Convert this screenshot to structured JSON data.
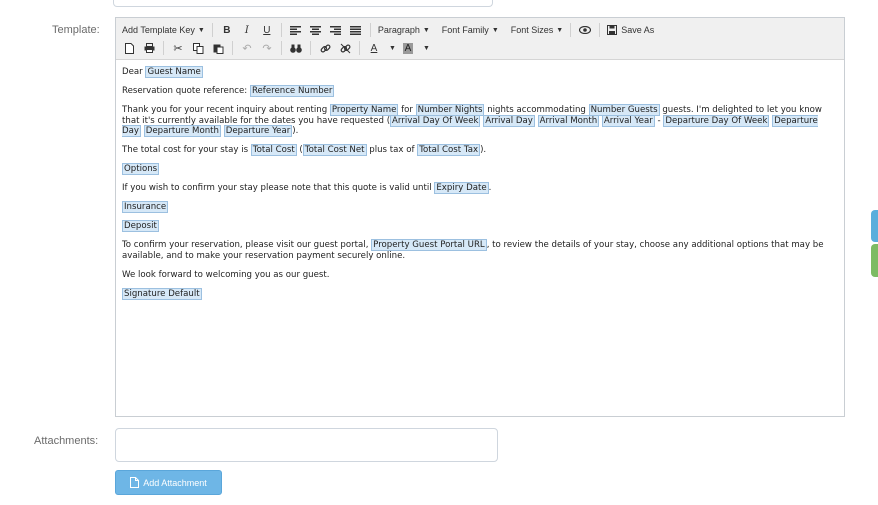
{
  "form": {
    "template_label": "Template:",
    "attachments_label": "Attachments:",
    "add_attachment_label": "Add Attachment",
    "attachments_value": ""
  },
  "toolbar": {
    "add_template_key": "Add Template Key",
    "bold": "B",
    "italic": "I",
    "underline": "U",
    "paragraph": "Paragraph",
    "font_family": "Font Family",
    "font_sizes": "Font Sizes",
    "save_as": "Save As",
    "text_color": "A",
    "bg_color": "A"
  },
  "letter": {
    "p1": {
      "t1": "Dear ",
      "k1": "Guest Name"
    },
    "p2": {
      "t1": "Reservation quote reference: ",
      "k1": "Reference Number"
    },
    "p3": {
      "t1": "Thank you for your recent inquiry about renting ",
      "k1": "Property Name",
      "t2": " for ",
      "k2": "Number Nights",
      "t3": " nights accommodating ",
      "k3": "Number Guests",
      "t4": " guests. I'm delighted to let you know that it's currently available for the dates you have requested (",
      "k4": "Arrival Day Of Week",
      "t5": " ",
      "k5": "Arrival Day",
      "t6": " ",
      "k6": "Arrival Month",
      "t7": " ",
      "k7": "Arrival Year",
      "t8": " - ",
      "k8": "Departure Day Of Week",
      "t9": " ",
      "k9": "Departure Day",
      "t10": " ",
      "k10": "Departure Month",
      "t11": " ",
      "k11": "Departure Year",
      "t12": ")."
    },
    "p4": {
      "t1": "The total cost for your stay is ",
      "k1": "Total Cost",
      "t2": " (",
      "k2": "Total Cost Net",
      "t3": " plus tax of ",
      "k3": "Total Cost Tax",
      "t4": ")."
    },
    "p5": {
      "k1": "Options"
    },
    "p6": {
      "t1": "If you wish to confirm your stay please note that this quote is valid until ",
      "k1": "Expiry Date",
      "t2": "."
    },
    "p7": {
      "k1": "Insurance"
    },
    "p8": {
      "k1": "Deposit"
    },
    "p9": {
      "t1": "To confirm your reservation, please visit our guest portal, ",
      "k1": "Property Guest Portal URL",
      "t2": ", to review the details of your stay, choose any additional options that may be available, and to make your reservation payment securely online."
    },
    "p10": {
      "t1": "We look forward to welcoming you as our guest."
    },
    "p11": {
      "k1": "Signature Default"
    }
  },
  "colors": {
    "placeholder_bg": "#d6e8f7",
    "placeholder_border": "#9cc0e0",
    "button_bg": "#6eb6e6",
    "side_tab_blue": "#5aaedc",
    "side_tab_green": "#7dbb63"
  }
}
